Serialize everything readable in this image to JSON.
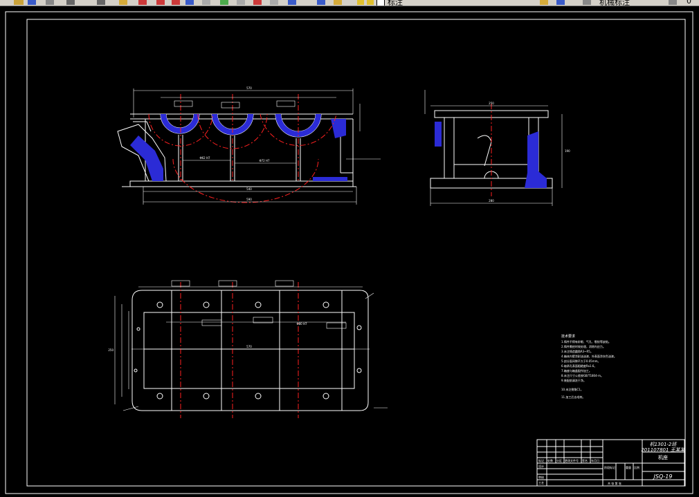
{
  "toolbar": {
    "layer_label": "标注",
    "style_label": "机械标注",
    "right_value": "0"
  },
  "drawing": {
    "background": "#000000",
    "line_color": "#ffffff",
    "center_color": "#ff2020",
    "dim_color": "#ffffff",
    "hatch_color": "#2b2bd6"
  },
  "tech_requirements": {
    "heading": "技术要求",
    "lines": [
      "1.铸件不得有砂眼、气孔、裂纹等缺陷。",
      "2.铸件需经时效处理，消除内应力。",
      "3.未注铸造圆角R3~R5。",
      "4.箱体内壁涂耐油油漆，外表面涂灰色油漆。",
      "5.剖分面间隙不大于0.05mm。",
      "6.轴承孔表面粗糙度Ra1.6。",
      "7.箱座与箱盖配作加工。",
      "8.未注尺寸公差按GB/T1804-m。",
      "9.装配前清洗干净。",
      "10.未注倒角C1。",
      "11.加工后去毛刺。"
    ]
  },
  "title_block": {
    "school_line1": "机1301-2班",
    "school_line2": "201107801 王某某",
    "part_name": "机座",
    "drawing_no": "JSQ-19",
    "labels": [
      "标记",
      "处数",
      "分区",
      "更改文件号",
      "签名",
      "年月日"
    ],
    "label_design": "设计",
    "label_audit": "审核",
    "label_process": "工艺",
    "label_stage": "阶段标记",
    "label_weight": "重量",
    "label_scale": "比例",
    "label_sheets": "共 张 第 张"
  },
  "dimensions": {
    "front_total": "570",
    "front_base": "540",
    "front_base2": "590",
    "side_width": "250",
    "side_height": "190",
    "side_base": "280",
    "top_length": "570",
    "top_width": "250",
    "center_1": "Φ62 H7",
    "center_2": "Φ72 H7",
    "center_3": "Φ80 H7"
  }
}
